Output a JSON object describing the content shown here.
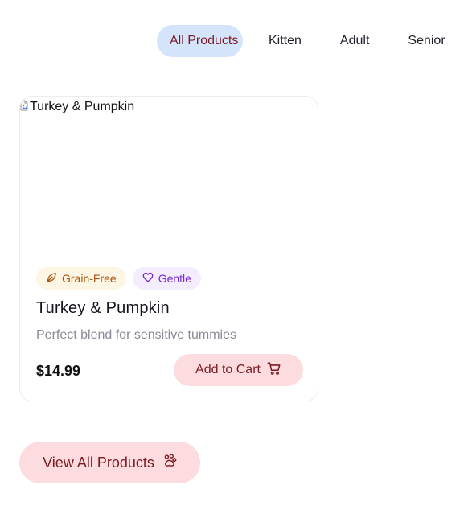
{
  "filters": {
    "tabs": [
      {
        "label": "All Products",
        "active": true
      },
      {
        "label": "Kitten",
        "active": false
      },
      {
        "label": "Adult",
        "active": false
      },
      {
        "label": "Senior",
        "active": false
      }
    ]
  },
  "product": {
    "image_alt": "Turkey & Pumpkin",
    "badges": [
      {
        "label": "Grain-Free",
        "icon": "leaf-icon"
      },
      {
        "label": "Gentle",
        "icon": "heart-icon"
      }
    ],
    "name": "Turkey & Pumpkin",
    "description": "Perfect blend for sensitive tummies",
    "price": "$14.99",
    "add_to_cart_label": "Add to Cart",
    "add_to_cart_icon": "cart-icon"
  },
  "view_all": {
    "label": "View All Products",
    "icon": "paw-icon"
  },
  "colors": {
    "accent_text": "#7a1c24",
    "accent_bg": "#fcdcde",
    "active_tab_bg": "#d4e4fb",
    "grain_badge_bg": "#fdf6e4",
    "grain_badge_text": "#a8570f",
    "gentle_badge_bg": "#f3edfd",
    "gentle_badge_text": "#7a2bd0"
  }
}
